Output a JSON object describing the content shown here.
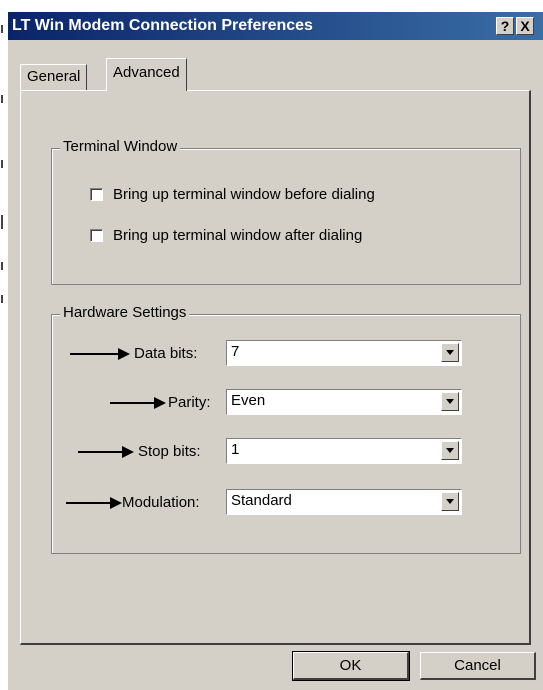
{
  "window": {
    "title": "LT Win Modem Connection Preferences",
    "help_button": "?",
    "close_button": "X"
  },
  "tabs": [
    {
      "label": "General",
      "selected": false
    },
    {
      "label": "Advanced",
      "selected": true
    }
  ],
  "terminal_group": {
    "title": "Terminal Window",
    "options": [
      {
        "label": "Bring up terminal window before dialing",
        "checked": false
      },
      {
        "label": "Bring up terminal window after dialing",
        "checked": false
      }
    ]
  },
  "hardware_group": {
    "title": "Hardware Settings",
    "fields": [
      {
        "label": "Data bits:",
        "value": "7"
      },
      {
        "label": "Parity:",
        "value": "Even"
      },
      {
        "label": "Stop bits:",
        "value": "1"
      },
      {
        "label": "Modulation:",
        "value": "Standard"
      }
    ]
  },
  "buttons": {
    "ok": "OK",
    "cancel": "Cancel"
  },
  "colors": {
    "title_bar_start": "#0a246a",
    "title_bar_end": "#3a6ea5",
    "dialog_face": "#d4d0c8"
  }
}
